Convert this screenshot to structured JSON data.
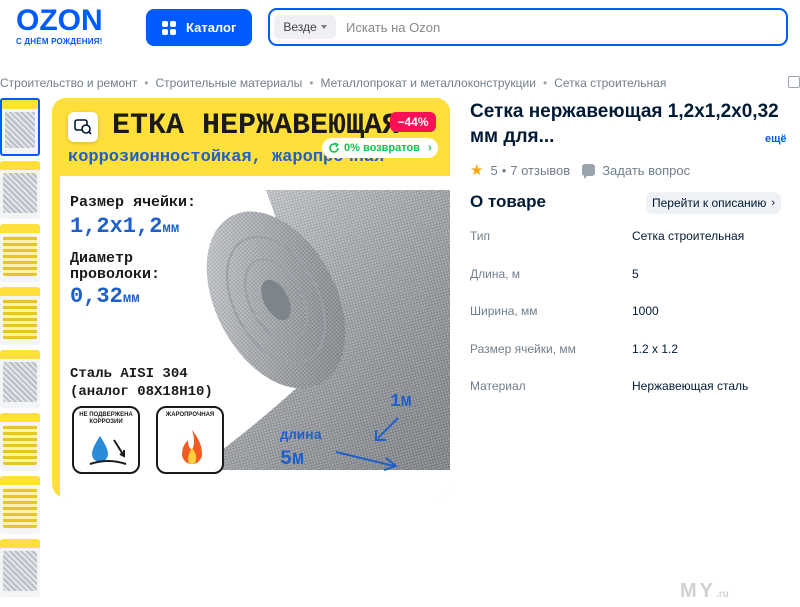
{
  "header": {
    "logo": "OZON",
    "logo_tagline": "С ДНЁМ РОЖДЕНИЯ!",
    "catalog_label": "Каталог",
    "search_scope": "Везде",
    "search_placeholder": "Искать на Ozon"
  },
  "breadcrumbs": [
    "Строительство и ремонт",
    "Строительные материалы",
    "Металлопрокат и металлоконструкции",
    "Сетка строительная"
  ],
  "gallery": {
    "thumbnail_count": 8,
    "main_image": {
      "headline": "ЕТКА НЕРЖАВЕЮЩАЯ",
      "subheadline": "коррозионностойкая, жаропрочная",
      "cell_size_label": "Размер ячейки:",
      "cell_size_value": "1,2х1,2",
      "cell_size_unit": "мм",
      "wire_label_1": "Диаметр",
      "wire_label_2": "проволоки:",
      "wire_value": "0,32",
      "wire_unit": "мм",
      "steel_line_1": "Сталь AISI 304",
      "steel_line_2": "(аналог 08Х18Н10)",
      "width_label": "1м",
      "length_word": "длина",
      "length_value": "5м",
      "icon1_caption": "НЕ ПОДВЕРЖЕНА КОРРОЗИИ",
      "icon2_caption": "ЖАРОПРОЧНАЯ"
    },
    "discount_badge": "−44%",
    "returns_badge": "0% возвратов"
  },
  "product": {
    "title": "Сетка нержавеющая 1,2х1,2х0,32 мм для...",
    "more_link": "ещё",
    "rating": "5",
    "reviews": "7 отзывов",
    "ask_question": "Задать вопрос",
    "about_title": "О товаре",
    "goto_description": "Перейти к описанию",
    "attributes": [
      {
        "key": "Тип",
        "value": "Сетка строительная"
      },
      {
        "key": "Длина, м",
        "value": "5"
      },
      {
        "key": "Ширина, мм",
        "value": "1000"
      },
      {
        "key": "Размер ячейки, мм",
        "value": "1.2 x 1.2"
      },
      {
        "key": "Материал",
        "value": "Нержавеющая сталь"
      }
    ]
  },
  "watermark": {
    "text": "MY",
    "suffix": ".ru"
  },
  "colors": {
    "brand": "#005bff",
    "discount": "#f91155",
    "returns": "#10c44c",
    "star": "#ffa800",
    "banner": "#ffe03b"
  }
}
